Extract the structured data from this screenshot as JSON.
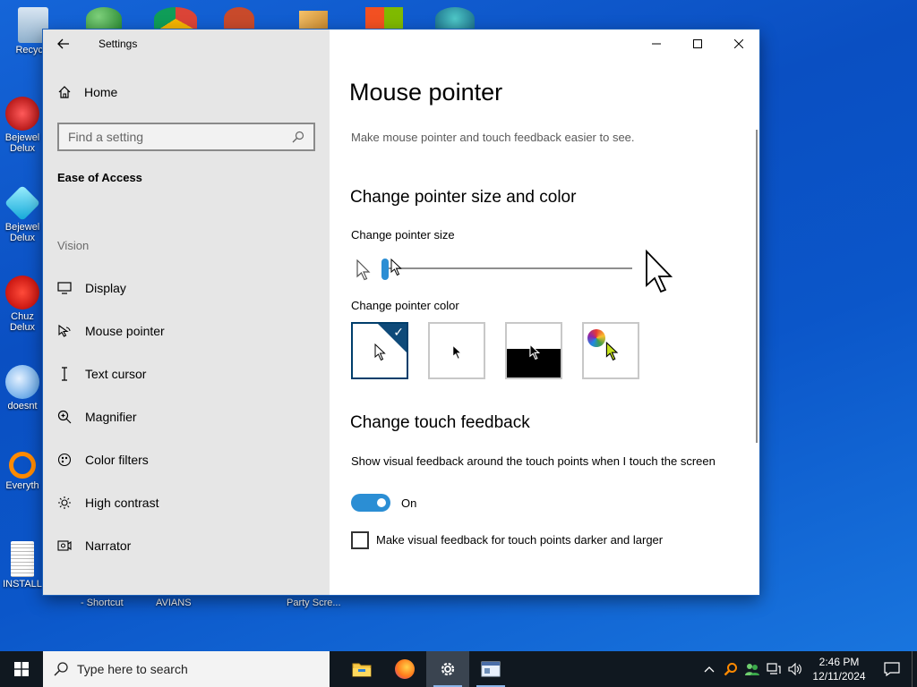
{
  "desktop": {
    "icons": [
      {
        "label": "Recycle"
      },
      {
        "label": "Bejewel Delux"
      },
      {
        "label": "Bejewel Delux"
      },
      {
        "label": "Chuz Delux"
      },
      {
        "label": "doesnt"
      },
      {
        "label": "Everyth"
      },
      {
        "label": "INSTALL"
      }
    ],
    "bottom_labels": [
      "- Shortcut",
      "AVIANS",
      "Party Scre..."
    ]
  },
  "window": {
    "title": "Settings",
    "sidebar": {
      "home": "Home",
      "search_placeholder": "Find a setting",
      "category": "Ease of Access",
      "group": "Vision",
      "items": [
        {
          "label": "Display",
          "icon": "display-icon"
        },
        {
          "label": "Mouse pointer",
          "icon": "mouse-pointer-icon"
        },
        {
          "label": "Text cursor",
          "icon": "text-cursor-icon"
        },
        {
          "label": "Magnifier",
          "icon": "magnifier-icon"
        },
        {
          "label": "Color filters",
          "icon": "color-filters-icon"
        },
        {
          "label": "High contrast",
          "icon": "high-contrast-icon"
        },
        {
          "label": "Narrator",
          "icon": "narrator-icon"
        }
      ]
    },
    "content": {
      "title": "Mouse pointer",
      "description": "Make mouse pointer and touch feedback easier to see.",
      "size_color_heading": "Change pointer size and color",
      "size_label": "Change pointer size",
      "size_value": 1,
      "color_label": "Change pointer color",
      "color_options": [
        "white",
        "black",
        "inverted",
        "custom"
      ],
      "selected_color": "white",
      "touch_heading": "Change touch feedback",
      "touch_description": "Show visual feedback around the touch points when I touch the screen",
      "toggle_state": "On",
      "checkbox_label": "Make visual feedback for touch points darker and larger",
      "checkbox_checked": false
    }
  },
  "taskbar": {
    "search_placeholder": "Type here to search",
    "time": "2:46 PM",
    "date": "12/11/2024"
  },
  "colors": {
    "accent": "#2b8ed4",
    "sidebar_bg": "#e6e6e6",
    "selected_border": "#003e6b"
  }
}
